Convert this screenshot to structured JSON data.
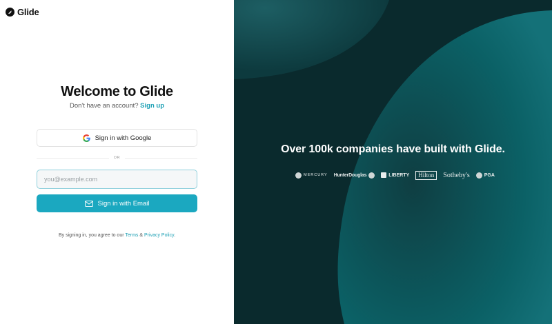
{
  "brand": {
    "name": "Glide",
    "icon": "glide-logo-icon"
  },
  "login": {
    "title": "Welcome to Glide",
    "no_account_text": "Don't have an account?",
    "sign_up_label": "Sign up",
    "google_button_label": "Sign in with Google",
    "google_icon": "google-icon",
    "divider_text": "OR",
    "email_placeholder": "you@example.com",
    "email_value": "",
    "email_button_label": "Sign in with Email",
    "email_icon": "mail-icon",
    "terms_prefix": "By signing in, you agree to our",
    "terms_link": "Terms",
    "terms_and": "&",
    "privacy_link": "Privacy Policy",
    "terms_suffix": "."
  },
  "promo": {
    "headline": "Over 100k companies have built with Glide.",
    "brands": [
      "MERCURY",
      "HunterDouglas",
      "LIBERTY",
      "Hilton",
      "Sotheby's",
      "PGA"
    ]
  },
  "colors": {
    "accent": "#1ba8c0",
    "link": "#1b9fb4",
    "promo_background": "#0a2c2f"
  }
}
